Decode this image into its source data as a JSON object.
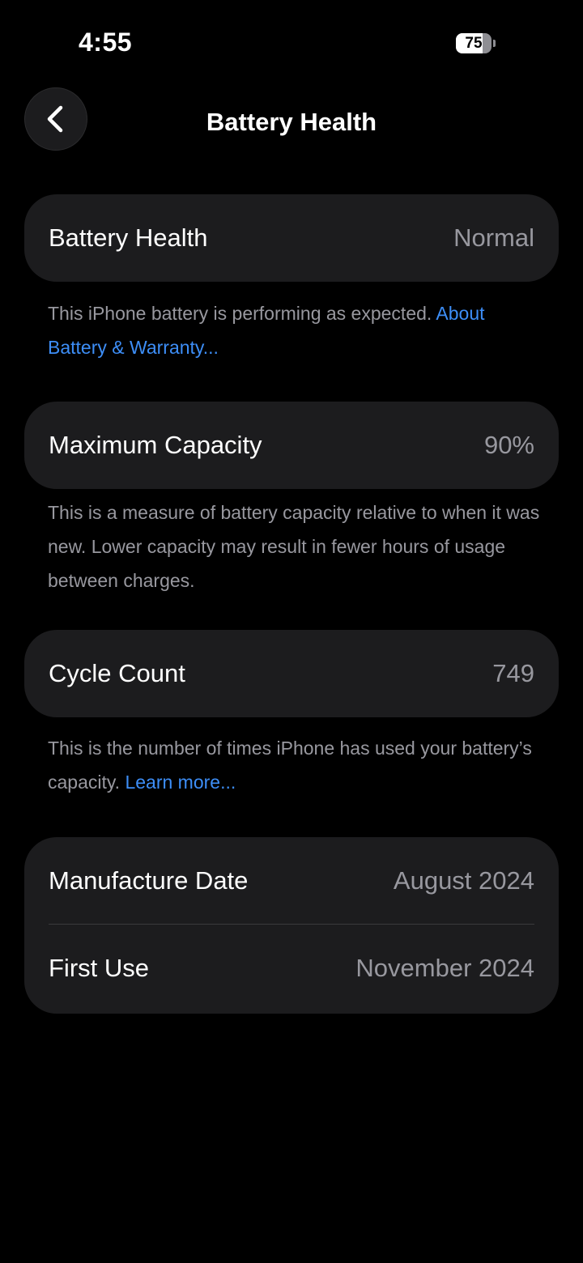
{
  "status_bar": {
    "time": "4:55",
    "battery_level_text": "75",
    "battery_fraction": 0.75
  },
  "nav": {
    "title": "Battery Health",
    "back_icon": "chevron-left-icon"
  },
  "battery_health": {
    "label": "Battery Health",
    "value": "Normal",
    "footnote_text": "This iPhone battery is performing as expected. ",
    "footnote_link": "About Battery & Warranty..."
  },
  "maximum_capacity": {
    "label": "Maximum Capacity",
    "value": "90%",
    "footnote_text": "This is a measure of battery capacity relative to when it was new. Lower capacity may result in fewer hours of usage between charges."
  },
  "cycle_count": {
    "label": "Cycle Count",
    "value": "749",
    "footnote_text": "This is the number of times iPhone has used your battery’s capacity. ",
    "footnote_link": "Learn more..."
  },
  "dates": {
    "manufacture_label": "Manufacture Date",
    "manufacture_value": "August 2024",
    "first_use_label": "First Use",
    "first_use_value": "November 2024"
  },
  "colors": {
    "background": "#000000",
    "card": "#1c1c1e",
    "secondary_text": "#98989f",
    "link": "#3d8ef7"
  }
}
